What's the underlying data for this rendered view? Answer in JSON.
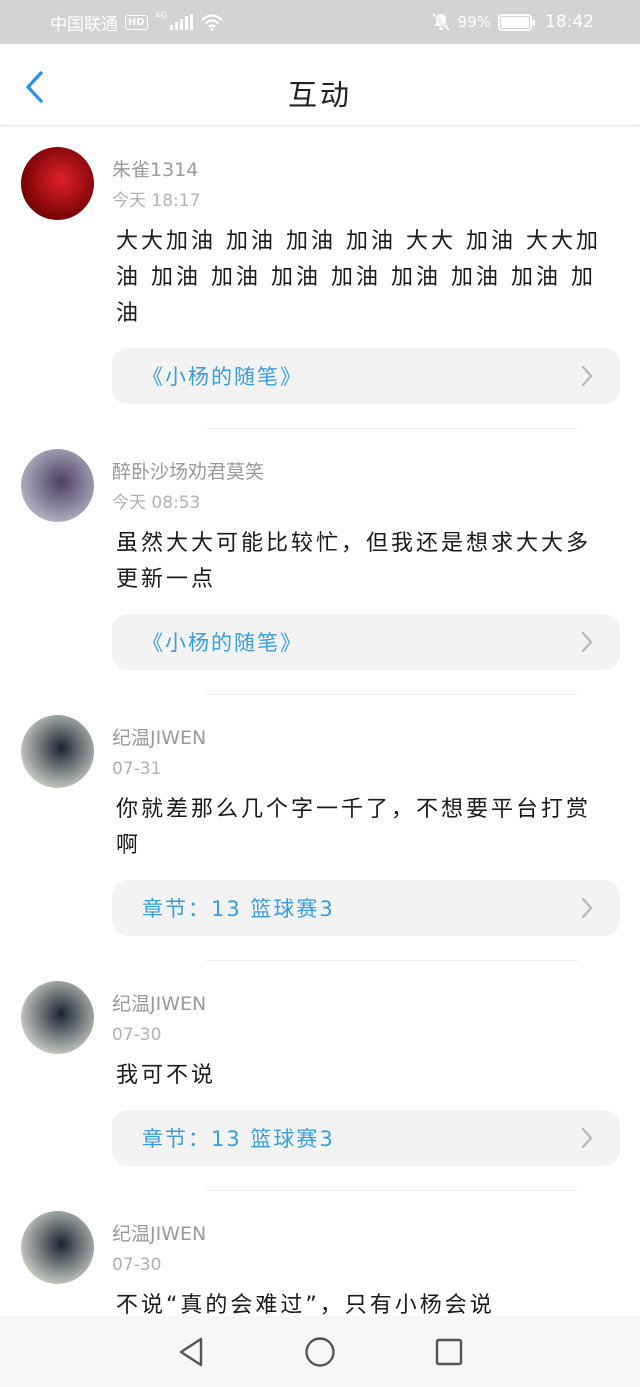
{
  "status_bar": {
    "carrier": "中国联通",
    "hd": "HD",
    "network": "4G",
    "battery": "99%",
    "battery_level": 0.99,
    "time": "18:42"
  },
  "nav": {
    "title": "互动",
    "back_icon": "chevron-left-icon"
  },
  "comments": [
    {
      "user": "朱雀1314",
      "time": "今天 18:17",
      "text": "大大加油 加油 加油 加油 大大 加油 大大加油 加油 加油 加油 加油 加油 加油 加油 加油",
      "ref": "《小杨的随笔》",
      "avatar_colors": [
        "#6b0000",
        "#e0202a"
      ]
    },
    {
      "user": "醉卧沙场劝君莫笑",
      "time": "今天 08:53",
      "text": "虽然大大可能比较忙，但我还是想求大大多更新一点",
      "ref": "《小杨的随笔》",
      "avatar_colors": [
        "#b8b6c8",
        "#4b4060"
      ]
    },
    {
      "user": "纪温JIWEN",
      "time": "07-31",
      "text": "你就差那么几个字一千了，不想要平台打赏啊",
      "ref": "章节：13 篮球赛3",
      "avatar_colors": [
        "#cfd3c9",
        "#1c2434"
      ]
    },
    {
      "user": "纪温JIWEN",
      "time": "07-30",
      "text": "我可不说",
      "ref": "章节：13 篮球赛3",
      "avatar_colors": [
        "#cfd3c9",
        "#1c2434"
      ]
    },
    {
      "user": "纪温JIWEN",
      "time": "07-30",
      "text": "不说“真的会难过”，只有小杨会说",
      "ref": "",
      "avatar_colors": [
        "#cfd3c9",
        "#1c2434"
      ]
    }
  ],
  "bottom_nav": {
    "back": "triangle-back-icon",
    "home": "circle-home-icon",
    "recents": "square-recents-icon"
  }
}
